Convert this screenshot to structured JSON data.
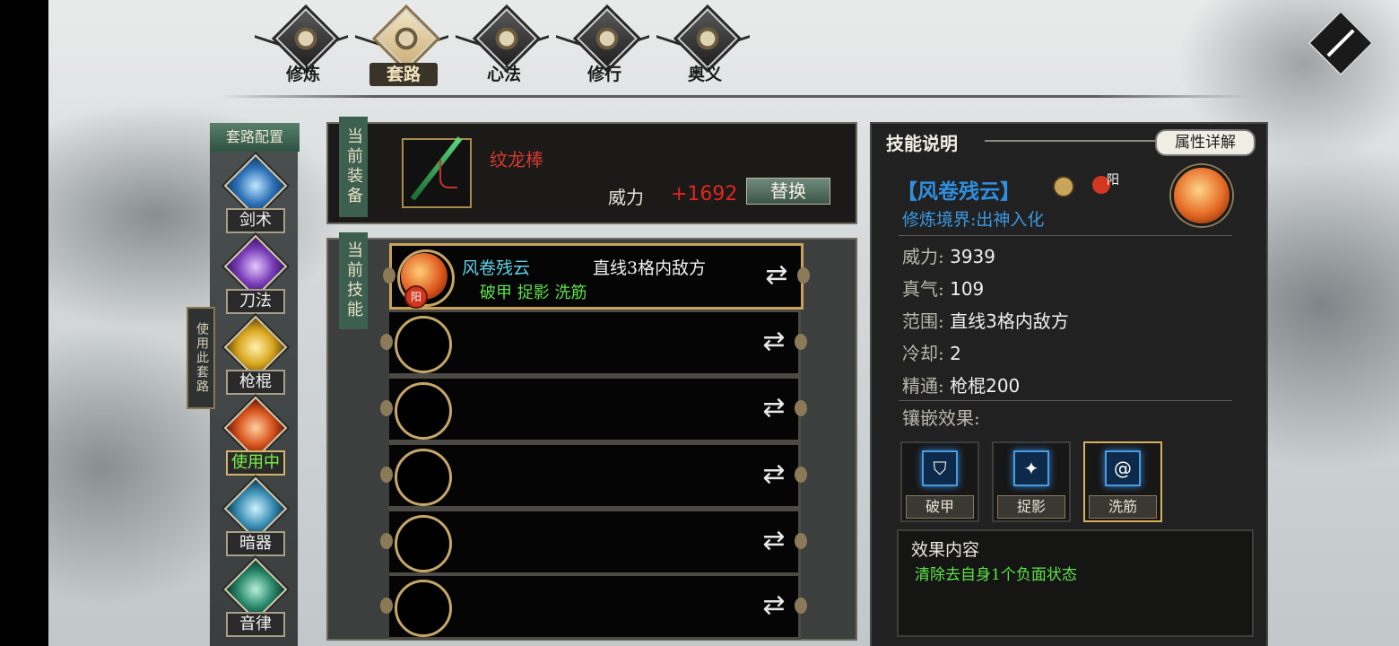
{
  "nav": {
    "tabs": [
      {
        "label": "修炼"
      },
      {
        "label": "套路"
      },
      {
        "label": "心法"
      },
      {
        "label": "修行"
      },
      {
        "label": "奥义"
      }
    ],
    "active": 1
  },
  "config": {
    "title": "套路配置",
    "use_button": "使用此套路",
    "categories": [
      {
        "label": "剑术",
        "color": "#5aa6e0"
      },
      {
        "label": "刀法",
        "color": "#a86adf"
      },
      {
        "label": "枪棍",
        "color": "#e8c13a"
      },
      {
        "label": "使用中",
        "color": "#e2642a"
      },
      {
        "label": "暗器",
        "color": "#6ab7d4"
      },
      {
        "label": "音律",
        "color": "#3aa48c"
      }
    ]
  },
  "equip": {
    "tab": "当前装备",
    "name": "纹龙棒",
    "power_label": "威力",
    "power_value": "+1692",
    "replace_label": "替换"
  },
  "skills": {
    "tab": "当前技能",
    "rows": [
      {
        "name": "风卷残云",
        "range": "直线3格内敌方",
        "tags": "破甲  捉影  洗筋",
        "element": "阳"
      },
      {},
      {},
      {},
      {},
      {}
    ],
    "swap_icon": "swap-icon"
  },
  "info": {
    "header": "技能说明",
    "detail_button": "属性详解",
    "title": "【风卷残云】",
    "element": "阳",
    "realm": "修炼境界:出神入化",
    "stats": [
      {
        "k": "威力:",
        "v": "3939"
      },
      {
        "k": "真气:",
        "v": "109"
      },
      {
        "k": "范围:",
        "v": "直线3格内敌方"
      },
      {
        "k": "冷却:",
        "v": "2"
      },
      {
        "k": "精通:",
        "v": "枪棍200"
      }
    ],
    "inlay_label": "镶嵌效果:",
    "gems": [
      {
        "label": "破甲",
        "icon": "shield-icon"
      },
      {
        "label": "捉影",
        "icon": "runner-icon"
      },
      {
        "label": "洗筋",
        "icon": "swirl-icon"
      }
    ],
    "effect_title": "效果内容",
    "effect_desc": "清除去自身1个负面状态"
  }
}
